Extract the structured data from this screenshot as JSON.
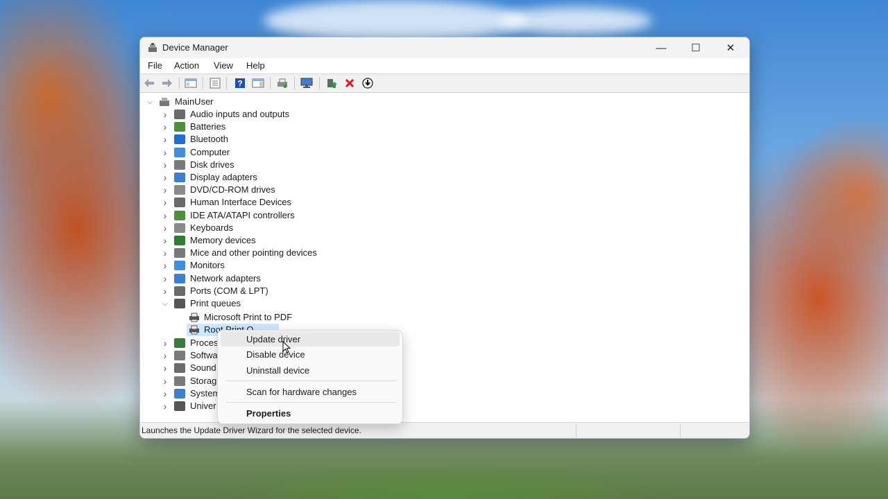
{
  "window": {
    "title": "Device Manager",
    "minimize_glyph": "—",
    "maximize_glyph": "☐",
    "close_glyph": "✕"
  },
  "menu": [
    "File",
    "Action",
    "View",
    "Help"
  ],
  "toolbar": {
    "buttons": [
      "back-arrow-icon",
      "forward-arrow-icon",
      "show-hide-console-tree-icon",
      "properties-icon",
      "help-icon",
      "action-pane-icon",
      "print-icon",
      "monitor-icon",
      "update-driver-icon",
      "uninstall-device-icon",
      "scan-hardware-icon"
    ]
  },
  "tree": {
    "root": "MainUser",
    "categories": [
      "Audio inputs and outputs",
      "Batteries",
      "Bluetooth",
      "Computer",
      "Disk drives",
      "Display adapters",
      "DVD/CD-ROM drives",
      "Human Interface Devices",
      "IDE ATA/ATAPI controllers",
      "Keyboards",
      "Memory devices",
      "Mice and other pointing devices",
      "Monitors",
      "Network adapters",
      "Ports (COM & LPT)",
      "Print queues"
    ],
    "print_queue_children": [
      "Microsoft Print to PDF",
      "Root Print Q"
    ],
    "categories_after": [
      "Proces",
      "Softwa",
      "Sound",
      "Storag",
      "System",
      "Univer"
    ]
  },
  "context_menu": {
    "update_driver": "Update driver",
    "disable_device": "Disable device",
    "uninstall_device": "Uninstall device",
    "scan_hardware": "Scan for hardware changes",
    "properties": "Properties"
  },
  "status": {
    "text": "Launches the Update Driver Wizard for the selected device."
  },
  "colors": {
    "selection": "#cce8ff",
    "uninstall_red": "#e81123",
    "help_blue": "#1a4fb3"
  }
}
